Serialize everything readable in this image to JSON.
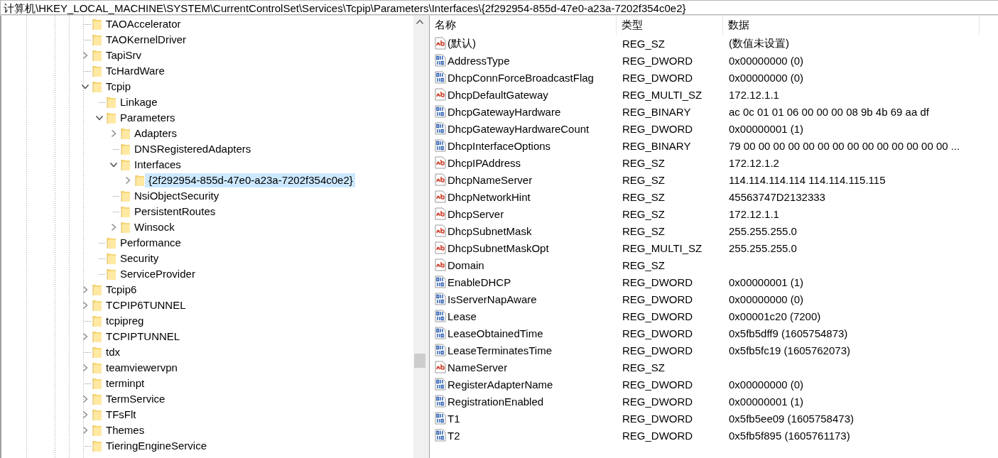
{
  "address_bar": {
    "path": "计算机\\HKEY_LOCAL_MACHINE\\SYSTEM\\CurrentControlSet\\Services\\Tcpip\\Parameters\\Interfaces\\{2f292954-855d-47e0-a23a-7202f354c0e2}"
  },
  "tree": {
    "items": [
      {
        "label": "TAOAccelerator",
        "expandable": false,
        "selected": false
      },
      {
        "label": "TAOKernelDriver",
        "expandable": false,
        "selected": false
      },
      {
        "label": "TapiSrv",
        "expandable": true,
        "expanded": false,
        "selected": false
      },
      {
        "label": "TcHardWare",
        "expandable": false,
        "selected": false
      },
      {
        "label": "Tcpip",
        "expandable": true,
        "expanded": true,
        "selected": false,
        "children": [
          {
            "label": "Linkage",
            "expandable": false,
            "selected": false
          },
          {
            "label": "Parameters",
            "expandable": true,
            "expanded": true,
            "selected": false,
            "children": [
              {
                "label": "Adapters",
                "expandable": true,
                "expanded": false,
                "selected": false
              },
              {
                "label": "DNSRegisteredAdapters",
                "expandable": false,
                "selected": false
              },
              {
                "label": "Interfaces",
                "expandable": true,
                "expanded": true,
                "selected": false,
                "children": [
                  {
                    "label": "{2f292954-855d-47e0-a23a-7202f354c0e2}",
                    "expandable": true,
                    "expanded": false,
                    "selected": true
                  }
                ]
              },
              {
                "label": "NsiObjectSecurity",
                "expandable": false,
                "selected": false
              },
              {
                "label": "PersistentRoutes",
                "expandable": false,
                "selected": false
              },
              {
                "label": "Winsock",
                "expandable": true,
                "expanded": false,
                "selected": false
              }
            ]
          },
          {
            "label": "Performance",
            "expandable": false,
            "selected": false
          },
          {
            "label": "Security",
            "expandable": false,
            "selected": false
          },
          {
            "label": "ServiceProvider",
            "expandable": false,
            "selected": false
          }
        ]
      },
      {
        "label": "Tcpip6",
        "expandable": true,
        "expanded": false,
        "selected": false
      },
      {
        "label": "TCPIP6TUNNEL",
        "expandable": true,
        "expanded": false,
        "selected": false
      },
      {
        "label": "tcpipreg",
        "expandable": false,
        "selected": false
      },
      {
        "label": "TCPIPTUNNEL",
        "expandable": true,
        "expanded": false,
        "selected": false
      },
      {
        "label": "tdx",
        "expandable": false,
        "selected": false
      },
      {
        "label": "teamviewervpn",
        "expandable": true,
        "expanded": false,
        "selected": false
      },
      {
        "label": "terminpt",
        "expandable": false,
        "selected": false
      },
      {
        "label": "TermService",
        "expandable": true,
        "expanded": false,
        "selected": false
      },
      {
        "label": "TFsFlt",
        "expandable": true,
        "expanded": false,
        "selected": false
      },
      {
        "label": "Themes",
        "expandable": true,
        "expanded": false,
        "selected": false
      },
      {
        "label": "TieringEngineService",
        "expandable": false,
        "selected": false
      }
    ]
  },
  "values_table": {
    "columns": [
      "名称",
      "类型",
      "数据"
    ],
    "rows": [
      {
        "kind": "string",
        "name": "(默认)",
        "type": "REG_SZ",
        "data": "(数值未设置)"
      },
      {
        "kind": "binary",
        "name": "AddressType",
        "type": "REG_DWORD",
        "data": "0x00000000 (0)"
      },
      {
        "kind": "binary",
        "name": "DhcpConnForceBroadcastFlag",
        "type": "REG_DWORD",
        "data": "0x00000000 (0)"
      },
      {
        "kind": "string",
        "name": "DhcpDefaultGateway",
        "type": "REG_MULTI_SZ",
        "data": "172.12.1.1"
      },
      {
        "kind": "binary",
        "name": "DhcpGatewayHardware",
        "type": "REG_BINARY",
        "data": "ac 0c 01 01 06 00 00 00 08 9b 4b 69 aa df"
      },
      {
        "kind": "binary",
        "name": "DhcpGatewayHardwareCount",
        "type": "REG_DWORD",
        "data": "0x00000001 (1)"
      },
      {
        "kind": "binary",
        "name": "DhcpInterfaceOptions",
        "type": "REG_BINARY",
        "data": "79 00 00 00 00 00 00 00 00 00 00 00 00 00 00 ..."
      },
      {
        "kind": "string",
        "name": "DhcpIPAddress",
        "type": "REG_SZ",
        "data": "172.12.1.2"
      },
      {
        "kind": "string",
        "name": "DhcpNameServer",
        "type": "REG_SZ",
        "data": "114.114.114.114 114.114.115.115"
      },
      {
        "kind": "string",
        "name": "DhcpNetworkHint",
        "type": "REG_SZ",
        "data": "45563747D2132333"
      },
      {
        "kind": "string",
        "name": "DhcpServer",
        "type": "REG_SZ",
        "data": "172.12.1.1"
      },
      {
        "kind": "string",
        "name": "DhcpSubnetMask",
        "type": "REG_SZ",
        "data": "255.255.255.0"
      },
      {
        "kind": "string",
        "name": "DhcpSubnetMaskOpt",
        "type": "REG_MULTI_SZ",
        "data": "255.255.255.0"
      },
      {
        "kind": "string",
        "name": "Domain",
        "type": "REG_SZ"
      },
      {
        "kind": "binary",
        "name": "EnableDHCP",
        "type": "REG_DWORD",
        "data": "0x00000001 (1)"
      },
      {
        "kind": "binary",
        "name": "IsServerNapAware",
        "type": "REG_DWORD",
        "data": "0x00000000 (0)"
      },
      {
        "kind": "binary",
        "name": "Lease",
        "type": "REG_DWORD",
        "data": "0x00001c20 (7200)"
      },
      {
        "kind": "binary",
        "name": "LeaseObtainedTime",
        "type": "REG_DWORD",
        "data": "0x5fb5dff9 (1605754873)"
      },
      {
        "kind": "binary",
        "name": "LeaseTerminatesTime",
        "type": "REG_DWORD",
        "data": "0x5fb5fc19 (1605762073)"
      },
      {
        "kind": "string",
        "name": "NameServer",
        "type": "REG_SZ"
      },
      {
        "kind": "binary",
        "name": "RegisterAdapterName",
        "type": "REG_DWORD",
        "data": "0x00000000 (0)"
      },
      {
        "kind": "binary",
        "name": "RegistrationEnabled",
        "type": "REG_DWORD",
        "data": "0x00000001 (1)"
      },
      {
        "kind": "binary",
        "name": "T1",
        "type": "REG_DWORD",
        "data": "0x5fb5ee09 (1605758473)"
      },
      {
        "kind": "binary",
        "name": "T2",
        "type": "REG_DWORD",
        "data": "0x5fb5f895 (1605761173)"
      }
    ]
  }
}
